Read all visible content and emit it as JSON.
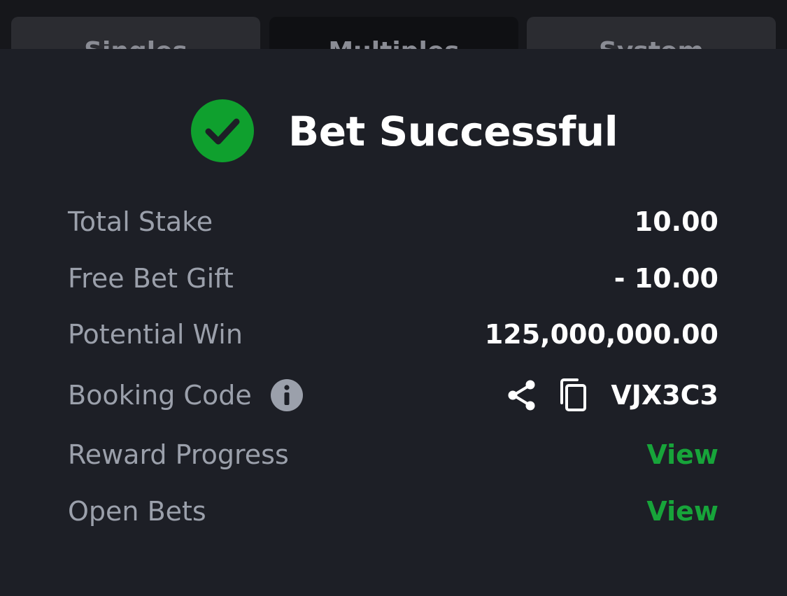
{
  "tabs": [
    {
      "label": "Singles"
    },
    {
      "label": "Multiples"
    },
    {
      "label": "System"
    }
  ],
  "header": {
    "title": "Bet Successful",
    "icon": "check-circle-icon",
    "icon_color": "#0fa02e"
  },
  "summary": {
    "total_stake": {
      "label": "Total Stake",
      "value": "10.00"
    },
    "free_bet_gift": {
      "label": "Free Bet Gift",
      "value": "- 10.00"
    },
    "potential_win": {
      "label": "Potential Win",
      "value": "125,000,000.00"
    },
    "booking_code": {
      "label": "Booking Code",
      "value": "VJX3C3",
      "info_icon": "info-icon",
      "share_icon": "share-icon",
      "copy_icon": "copy-icon"
    },
    "reward_progress": {
      "label": "Reward Progress",
      "link": "View"
    },
    "open_bets": {
      "label": "Open Bets",
      "link": "View"
    }
  },
  "colors": {
    "background": "#1d1f26",
    "accent_green": "#17a43a",
    "label_gray": "#9ba0ab",
    "text_white": "#ffffff"
  }
}
